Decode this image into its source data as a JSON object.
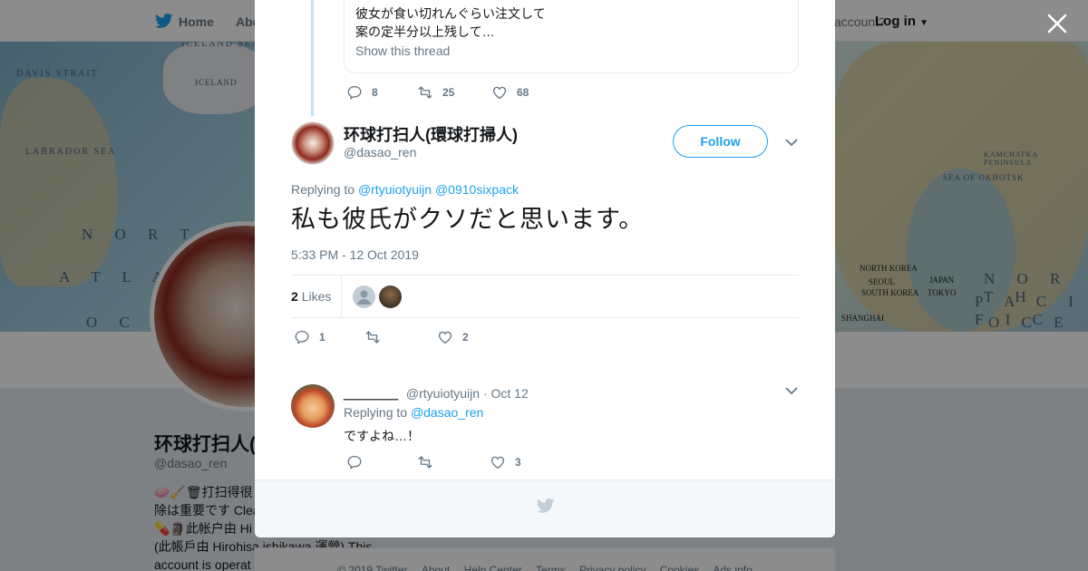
{
  "topbar": {
    "home_label": "Home",
    "about_label": "Abo",
    "account_text": "account?",
    "login_label": "Log in"
  },
  "banner": {
    "labels": [
      "DAVIS STRAIT",
      "LABRADOR SEA",
      "N O R T H",
      "A T L A N",
      "O C E",
      "ICELAND SEA",
      "ICELAND",
      "SEA OF OKHOTSK",
      "KAMCHATKA PENINSULA",
      "N O R T H",
      "P A C I F I C",
      "O C E A N",
      "NORTH KOREA",
      "SEOUL",
      "SOUTH KOREA",
      "SHANGHAI",
      "JAPAN",
      "TOKYO"
    ]
  },
  "profile": {
    "name": "环球打扫人(",
    "handle": "@dasao_ren",
    "bio_lines": [
      "🧼🧹🗑打扫得很",
      "除は重要です Clea",
      "💊🗿此帐户由 Hi",
      "(此帳戶由 Hirohisa ishikawa 運營) This",
      "account is operat"
    ]
  },
  "modal": {
    "quote": {
      "line1": "彼女が食い切れんぐらい注文して",
      "line2": "案の定半分以上残して…",
      "show_thread": "Show this thread"
    },
    "quote_actions": {
      "replies": "8",
      "retweets": "25",
      "likes": "68"
    },
    "tweet": {
      "author_name": "环球打扫人(環球打掃人)",
      "author_handle": "@dasao_ren",
      "follow_label": "Follow",
      "replying_prefix": "Replying to",
      "reply_to_1": "@rtyuiotyuijn",
      "reply_to_2": "@0910sixpack",
      "text": "私も彼氏がクソだと思います。",
      "timestamp": "5:33 PM - 12 Oct 2019",
      "likes_count": "2",
      "likes_label": "Likes",
      "actions": {
        "replies": "1",
        "retweets": "",
        "likes": "2"
      }
    },
    "reply": {
      "author_name": "＿＿＿＿",
      "author_handle": "@rtyuiotyuijn",
      "separator": "·",
      "date": "Oct 12",
      "replying_prefix": "Replying to",
      "reply_to": "@dasao_ren",
      "text": "ですよね…！",
      "actions": {
        "replies": "",
        "retweets": "",
        "likes": "3"
      }
    }
  },
  "footer": {
    "links": [
      "© 2019 Twitter",
      "About",
      "Help Center",
      "Terms",
      "Privacy policy",
      "Cookies",
      "Ads info"
    ]
  },
  "colors": {
    "accent": "#1da1f2",
    "muted": "#657786",
    "text": "#14171a",
    "border": "#e6ecf0"
  }
}
